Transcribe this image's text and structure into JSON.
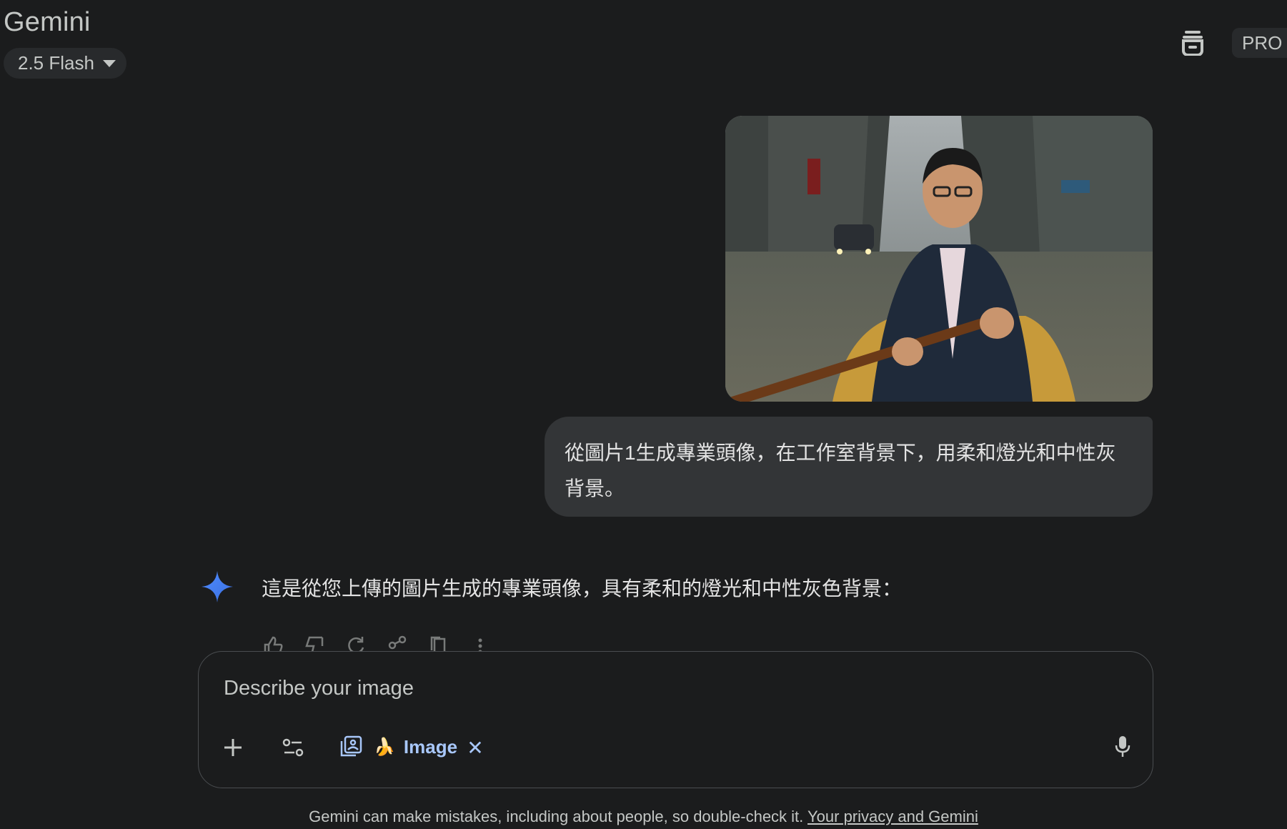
{
  "app": {
    "title": "Gemini"
  },
  "header": {
    "model_label": "2.5 Flash",
    "badge": "PRO"
  },
  "conversation": {
    "user_prompt": "從圖片1生成專業頭像，在工作室背景下，用柔和燈光和中性灰背景。",
    "model_response": "這是從您上傳的圖片生成的專業頭像，具有柔和的燈光和中性灰色背景："
  },
  "composer": {
    "placeholder": "Describe your image",
    "chip_label": "Image",
    "chip_emoji": "🍌",
    "chip_close": "✕"
  },
  "footer": {
    "disclaimer": "Gemini can make mistakes, including about people, so double-check it.",
    "privacy_link": "Your privacy and Gemini"
  },
  "icons": {
    "temp_chat": "temporary-chat-icon",
    "plus": "plus-icon",
    "tools": "tools-icon",
    "image_mode": "image-gallery-icon",
    "mic": "microphone-icon",
    "spark": "gemini-spark-icon"
  },
  "colors": {
    "background": "#1b1c1d",
    "bubble": "#333537",
    "accent": "#a8c7fa",
    "spark_blue": "#4e8cff"
  }
}
